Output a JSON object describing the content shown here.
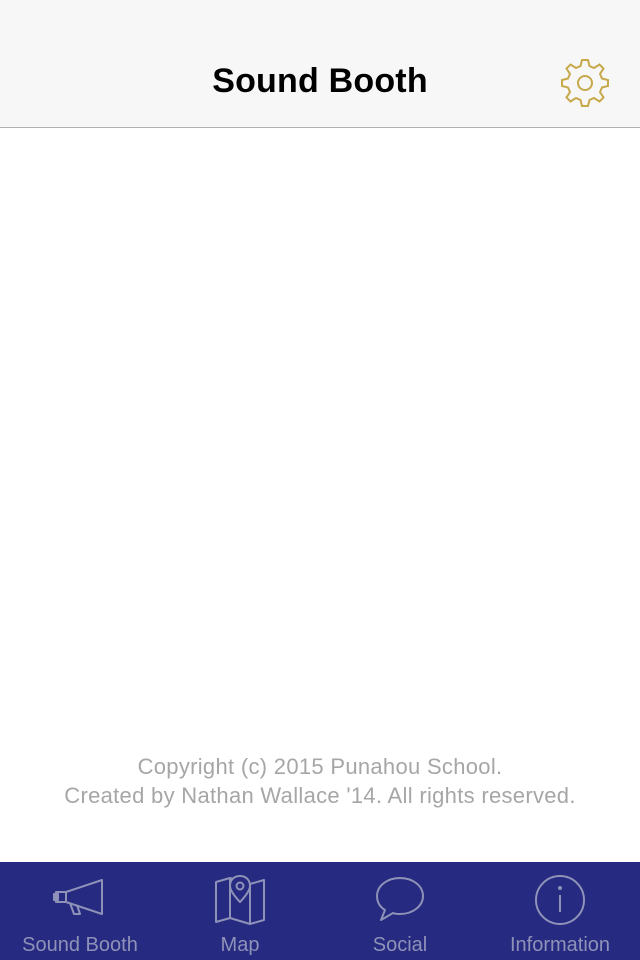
{
  "navbar": {
    "title": "Sound Booth",
    "settings_icon": "gear-icon",
    "accent_color": "#c7a94a"
  },
  "footer": {
    "copyright_line1": "Copyright (c) 2015 Punahou School.",
    "copyright_line2": "Created by Nathan Wallace '14. All rights reserved."
  },
  "tabbar": {
    "background": "#262a80",
    "items": [
      {
        "label": "Sound Booth",
        "icon": "megaphone-icon"
      },
      {
        "label": "Map",
        "icon": "map-pin-icon"
      },
      {
        "label": "Social",
        "icon": "speech-bubble-icon"
      },
      {
        "label": "Information",
        "icon": "info-icon"
      }
    ]
  }
}
